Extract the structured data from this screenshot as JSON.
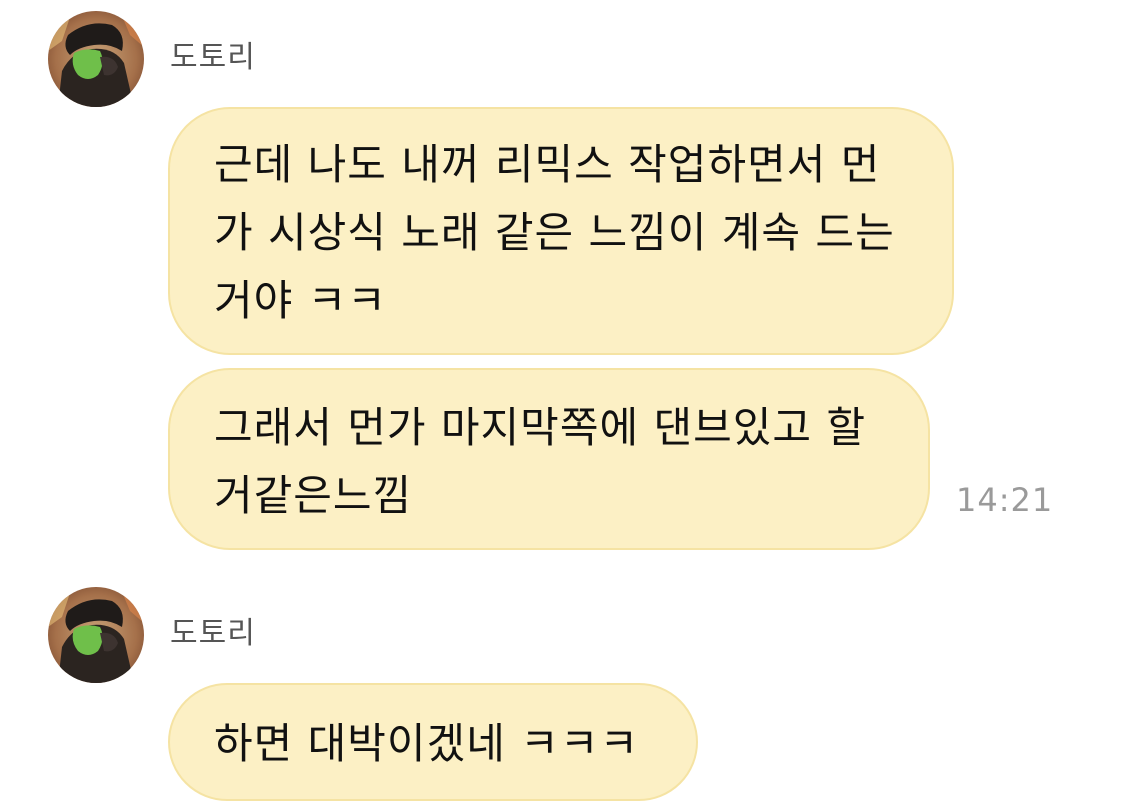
{
  "conversation": {
    "group1": {
      "sender": "도토리",
      "messages": [
        {
          "lines": [
            "근데 나도 내꺼 리믹스 작업하면서 먼",
            "가 시상식 노래 같은 느낌이 계속 드는",
            "거야 ㅋㅋ"
          ]
        },
        {
          "lines": [
            "그래서 먼가 마지막쪽에 댄브있고 할",
            "거같은느낌"
          ]
        }
      ],
      "time": "14:21"
    },
    "group2": {
      "sender": "도토리",
      "messages": [
        {
          "lines": [
            "하면 대박이겠네 ㅋㅋㅋ"
          ]
        }
      ]
    }
  },
  "colors": {
    "bubble_bg": "#fcf0c5",
    "bubble_border": "#f5e3a3",
    "sender_text": "#555555",
    "time_text": "#9a9a9a"
  },
  "icons": {
    "avatar": "profile-photo"
  }
}
